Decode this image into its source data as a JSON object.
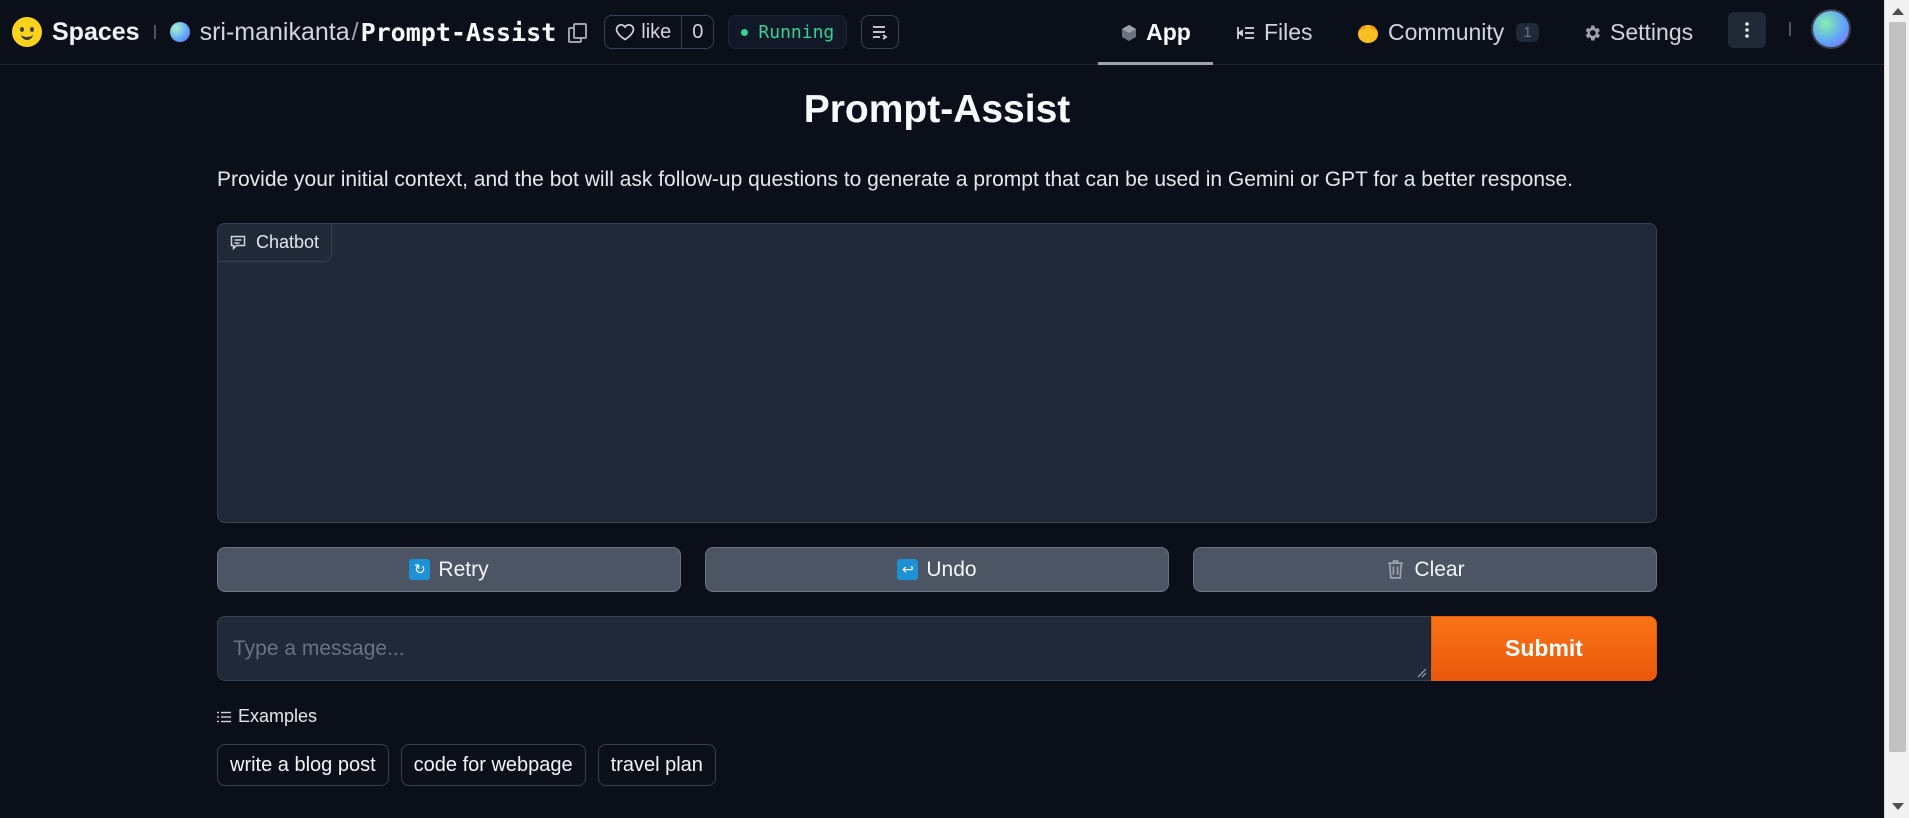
{
  "header": {
    "brand_label": "Spaces",
    "space_owner": "sri-manikanta",
    "space_separator": "/",
    "space_name": "Prompt-Assist",
    "like_label": "like",
    "like_count": "0",
    "status_label": "Running",
    "status_color": "#34d399"
  },
  "nav": {
    "tabs": [
      {
        "label": "App",
        "icon": "cube-icon",
        "active": true
      },
      {
        "label": "Files",
        "icon": "files-icon",
        "active": false
      },
      {
        "label": "Community",
        "icon": "community-icon",
        "count": "1",
        "active": false
      },
      {
        "label": "Settings",
        "icon": "gear-icon",
        "active": false
      }
    ]
  },
  "app": {
    "title": "Prompt-Assist",
    "description": "Provide your initial context, and the bot will ask follow-up questions to generate a prompt that can be used in Gemini or GPT for a better response.",
    "chatbot_label": "Chatbot",
    "buttons": {
      "retry": "Retry",
      "undo": "Undo",
      "clear": "Clear",
      "submit": "Submit"
    },
    "input_placeholder": "Type a message...",
    "input_value": "",
    "examples_label": "Examples",
    "examples": [
      "write a blog post",
      "code for webpage",
      "travel plan"
    ],
    "accent_color": "#f97316"
  }
}
